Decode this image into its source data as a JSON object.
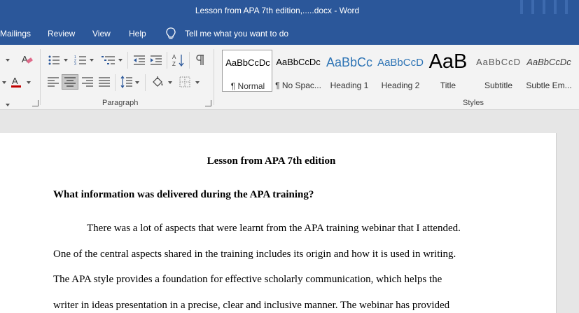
{
  "window": {
    "title": "Lesson from APA 7th edition,.....docx  -  Word"
  },
  "tabs": {
    "mailings": "Mailings",
    "review": "Review",
    "view": "View",
    "help": "Help",
    "tell_me": "Tell me what you want to do"
  },
  "ribbon": {
    "paragraph_label": "Paragraph",
    "styles_label": "Styles",
    "styles": [
      {
        "sample": "AaBbCcDc",
        "name": "¶ Normal"
      },
      {
        "sample": "AaBbCcDc",
        "name": "¶ No Spac..."
      },
      {
        "sample": "AaBbCc",
        "name": "Heading 1"
      },
      {
        "sample": "AaBbCcD",
        "name": "Heading 2"
      },
      {
        "sample": "AaB",
        "name": "Title"
      },
      {
        "sample": "AaBbCcD",
        "name": "Subtitle"
      },
      {
        "sample": "AaBbCcDc",
        "name": "Subtle Em..."
      }
    ],
    "colors": {
      "font_color": "#c00000",
      "heading_blue": "#2e74b5",
      "clear_format_pink": "#e06a8a"
    }
  },
  "document": {
    "title": "Lesson from APA 7th edition",
    "question": "What information was delivered during the APA training?",
    "lines": [
      "There was a lot of aspects that were learnt from the APA training webinar that I attended.",
      "One of the central aspects shared in the training includes its origin and how it is used in writing.",
      "The APA style provides a foundation for effective scholarly communication, which helps the",
      "writer in ideas presentation in a precise, clear and inclusive manner. The webinar has provided"
    ]
  },
  "theme": {
    "word_blue": "#2b579a",
    "ribbon_bg": "#f3f3f3",
    "canvas_bg": "#e6e6e6"
  }
}
